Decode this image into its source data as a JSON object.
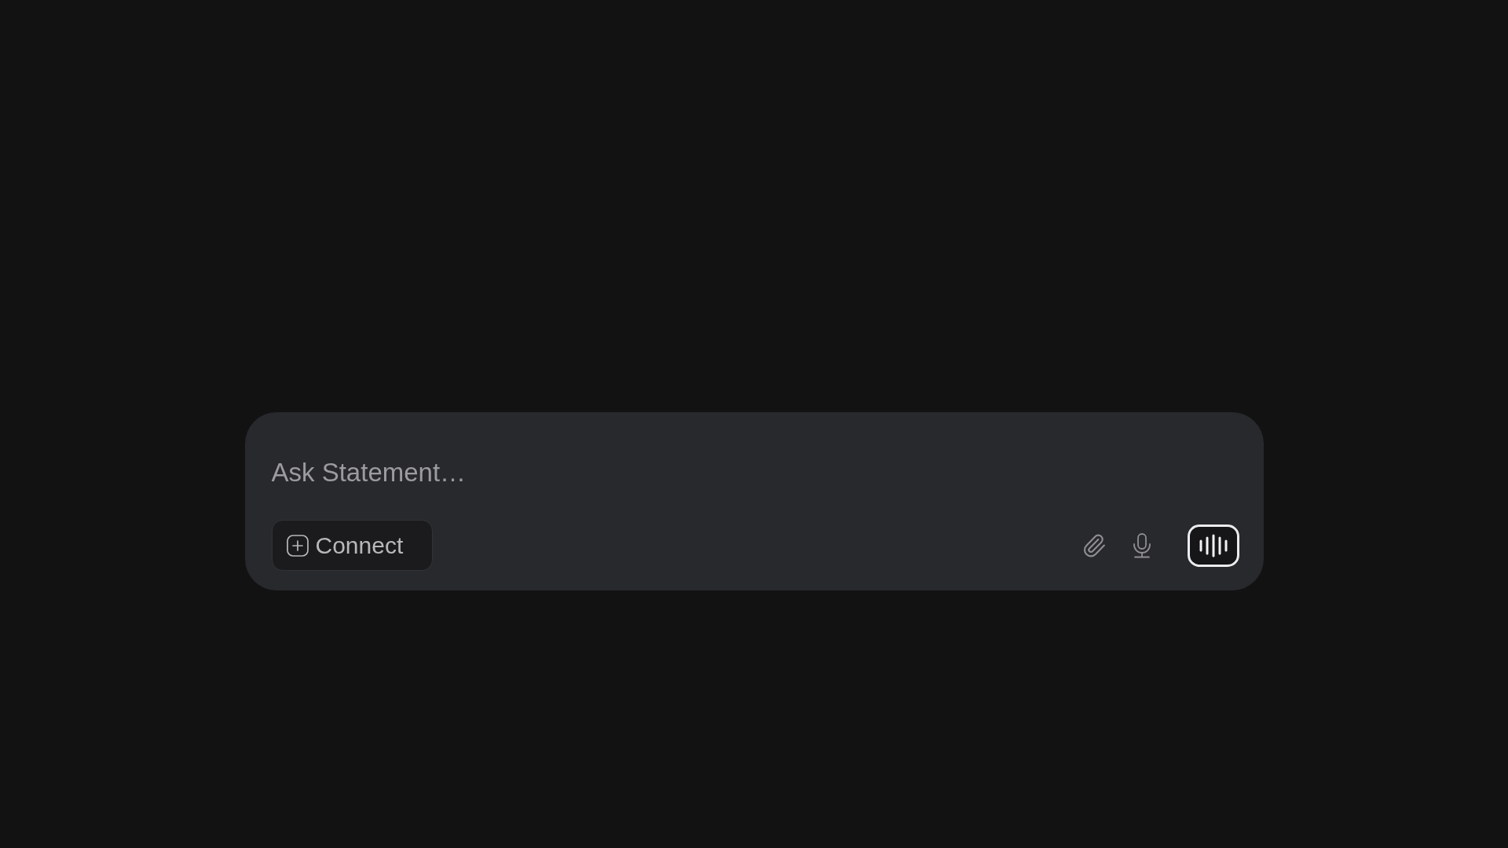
{
  "composer": {
    "placeholder": "Ask Statement…",
    "connect_button": {
      "label": "Connect"
    }
  }
}
